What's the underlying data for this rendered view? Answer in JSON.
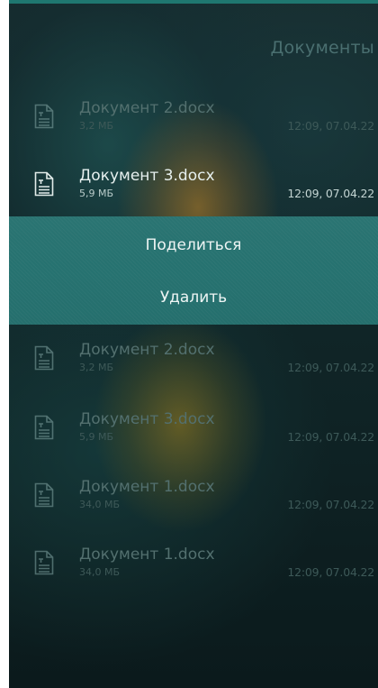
{
  "header": {
    "title": "Документы"
  },
  "documents_before": [
    {
      "name": "Документ 2.docx",
      "size": "3,2 МБ",
      "date": "12:09, 07.04.22",
      "icon": "document-icon"
    },
    {
      "name": "Документ 3.docx",
      "size": "5,9 МБ",
      "date": "12:09, 07.04.22",
      "icon": "document-icon"
    }
  ],
  "actions": {
    "share": "Поделиться",
    "delete": "Удалить"
  },
  "documents_after": [
    {
      "name": "Документ 2.docx",
      "size": "3,2 МБ",
      "date": "12:09, 07.04.22",
      "icon": "document-icon"
    },
    {
      "name": "Документ 3.docx",
      "size": "5,9 МБ",
      "date": "12:09, 07.04.22",
      "icon": "document-icon"
    },
    {
      "name": "Документ 1.docx",
      "size": "34,0 МБ",
      "date": "12:09, 07.04.22",
      "icon": "document-icon"
    },
    {
      "name": "Документ 1.docx",
      "size": "34,0 МБ",
      "date": "12:09, 07.04.22",
      "icon": "document-icon"
    }
  ],
  "colors": {
    "accent": "#1f7770",
    "panel": "#267270",
    "text_active": "#e6f0ef",
    "text_dim": "#53706f"
  }
}
